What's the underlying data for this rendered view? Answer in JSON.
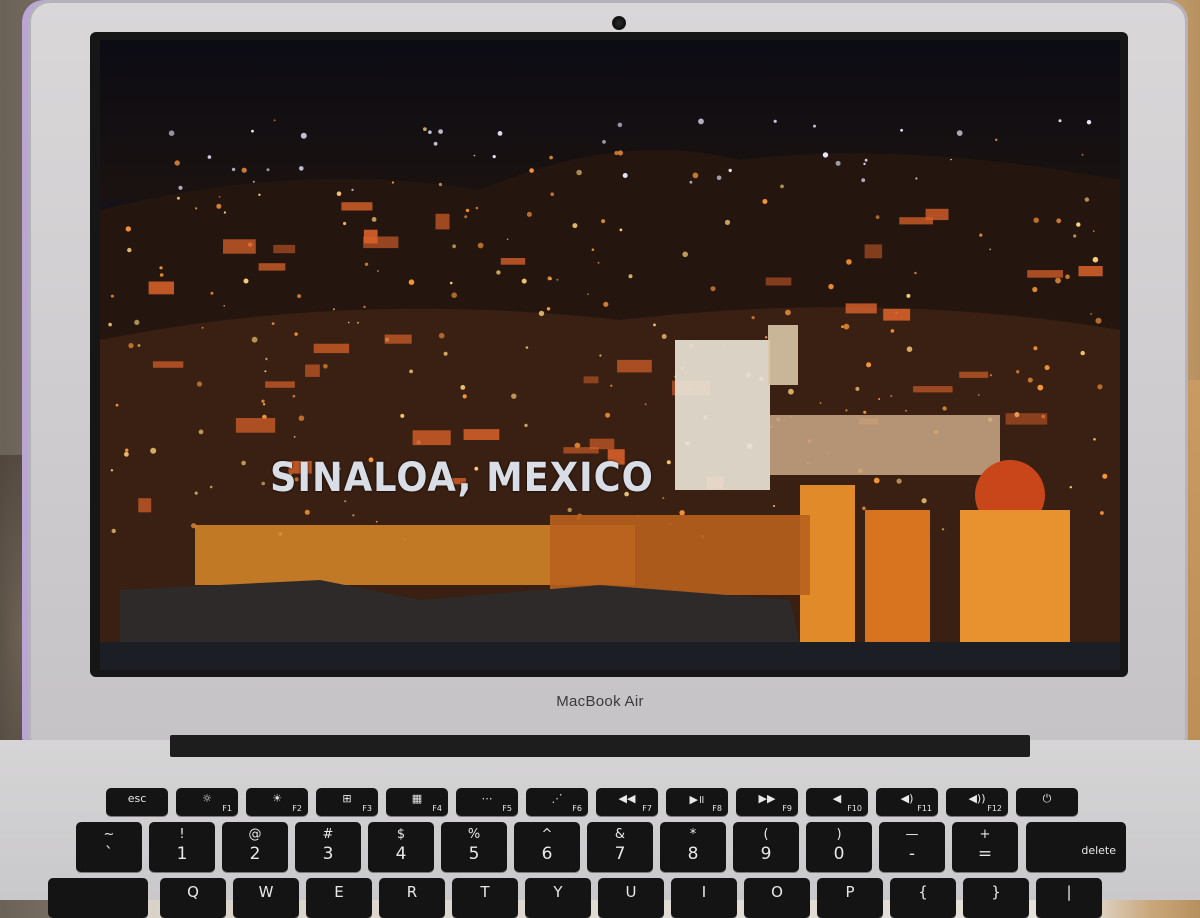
{
  "video": {
    "caption": "SINALOA, MEXICO"
  },
  "laptop": {
    "brand": "MacBook Air"
  },
  "keyboard": {
    "function_row": [
      {
        "glyph": "esc",
        "fn": ""
      },
      {
        "glyph": "☼",
        "fn": "F1"
      },
      {
        "glyph": "☀",
        "fn": "F2"
      },
      {
        "glyph": "⊞",
        "fn": "F3"
      },
      {
        "glyph": "▦",
        "fn": "F4"
      },
      {
        "glyph": "⋯",
        "fn": "F5"
      },
      {
        "glyph": "⋰",
        "fn": "F6"
      },
      {
        "glyph": "◀◀",
        "fn": "F7"
      },
      {
        "glyph": "▶॥",
        "fn": "F8"
      },
      {
        "glyph": "▶▶",
        "fn": "F9"
      },
      {
        "glyph": "◀",
        "fn": "F10"
      },
      {
        "glyph": "◀)",
        "fn": "F11"
      },
      {
        "glyph": "◀))",
        "fn": "F12"
      },
      {
        "glyph": "⏻",
        "fn": ""
      }
    ],
    "number_row": [
      {
        "top": "~",
        "bot": "`"
      },
      {
        "top": "!",
        "bot": "1"
      },
      {
        "top": "@",
        "bot": "2"
      },
      {
        "top": "#",
        "bot": "3"
      },
      {
        "top": "$",
        "bot": "4"
      },
      {
        "top": "%",
        "bot": "5"
      },
      {
        "top": "^",
        "bot": "6"
      },
      {
        "top": "&",
        "bot": "7"
      },
      {
        "top": "*",
        "bot": "8"
      },
      {
        "top": "(",
        "bot": "9"
      },
      {
        "top": ")",
        "bot": "0"
      },
      {
        "top": "—",
        "bot": "-"
      },
      {
        "top": "+",
        "bot": "="
      }
    ],
    "delete_label": "delete",
    "letter_row_partial": [
      "",
      "Q",
      "W",
      "E",
      "R",
      "T",
      "Y",
      "U",
      "I",
      "O",
      "P",
      "{",
      "}",
      "|"
    ]
  }
}
